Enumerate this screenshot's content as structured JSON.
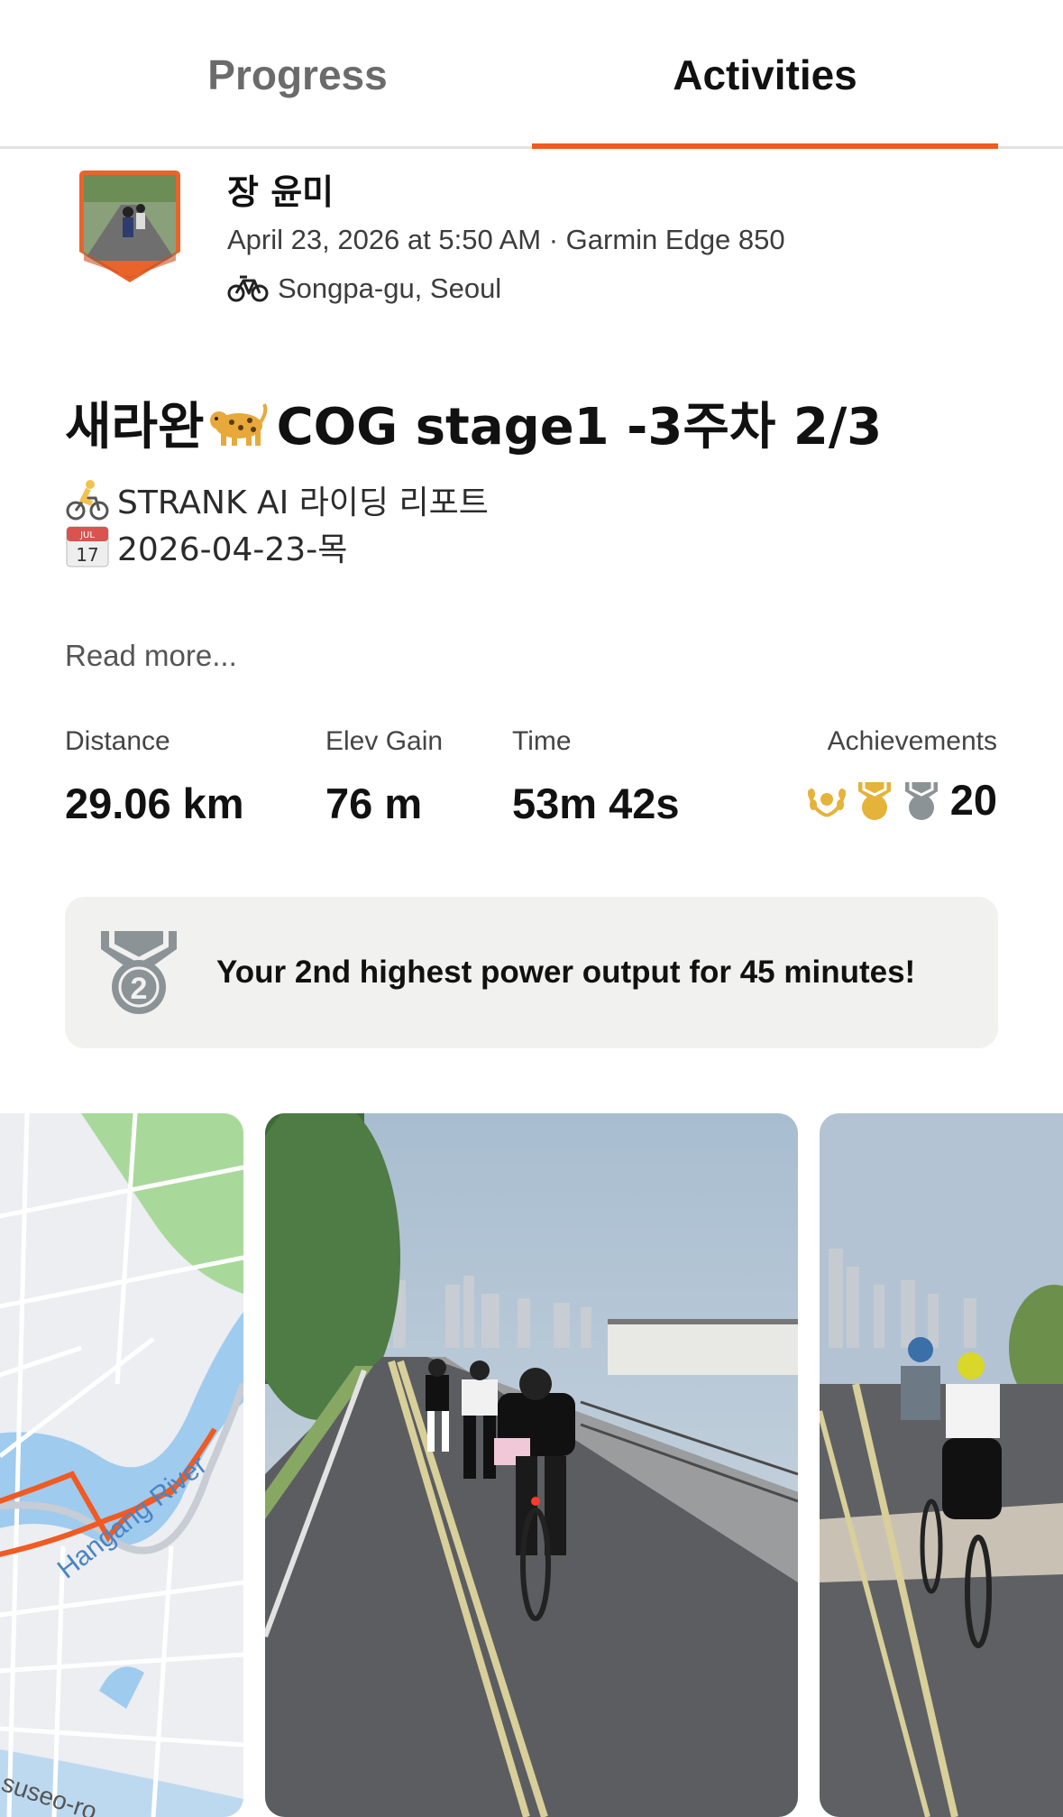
{
  "tabs": [
    {
      "label": "Progress",
      "active": false
    },
    {
      "label": "Activities",
      "active": true
    }
  ],
  "accent_color": "#f05a23",
  "athlete": {
    "name": "장 윤미",
    "meta": "April 23, 2026 at 5:50 AM · Garmin Edge 850",
    "location": "Songpa-gu, Seoul",
    "activity_icon": "bike-icon"
  },
  "activity": {
    "title_pre": "새라완",
    "title_post": "COG stage1 -3주차 2/3",
    "title_emoji": "leopard-emoji",
    "description_lines": [
      {
        "icon": "cyclist-emoji",
        "text": "STRANK AI 라이딩 리포트"
      },
      {
        "icon": "calendar-emoji",
        "text": "2026-04-23-목"
      }
    ],
    "read_more": "Read more..."
  },
  "stats": {
    "distance": {
      "label": "Distance",
      "value": "29.06 km"
    },
    "elev_gain": {
      "label": "Elev Gain",
      "value": "76 m"
    },
    "time": {
      "label": "Time",
      "value": "53m 42s"
    },
    "achievements": {
      "label": "Achievements",
      "count": "20",
      "icons": [
        "laurel-icon",
        "gold-medal-icon",
        "silver-medal-icon"
      ]
    }
  },
  "highlight": {
    "icon": "silver-medal-2-icon",
    "medal_number": "2",
    "text": "Your 2nd highest power output for 45 minutes!"
  },
  "map": {
    "labels": [
      "Hangang River",
      "suseo-ro"
    ]
  },
  "calendar_emoji": {
    "month": "JUL",
    "day": "17"
  }
}
